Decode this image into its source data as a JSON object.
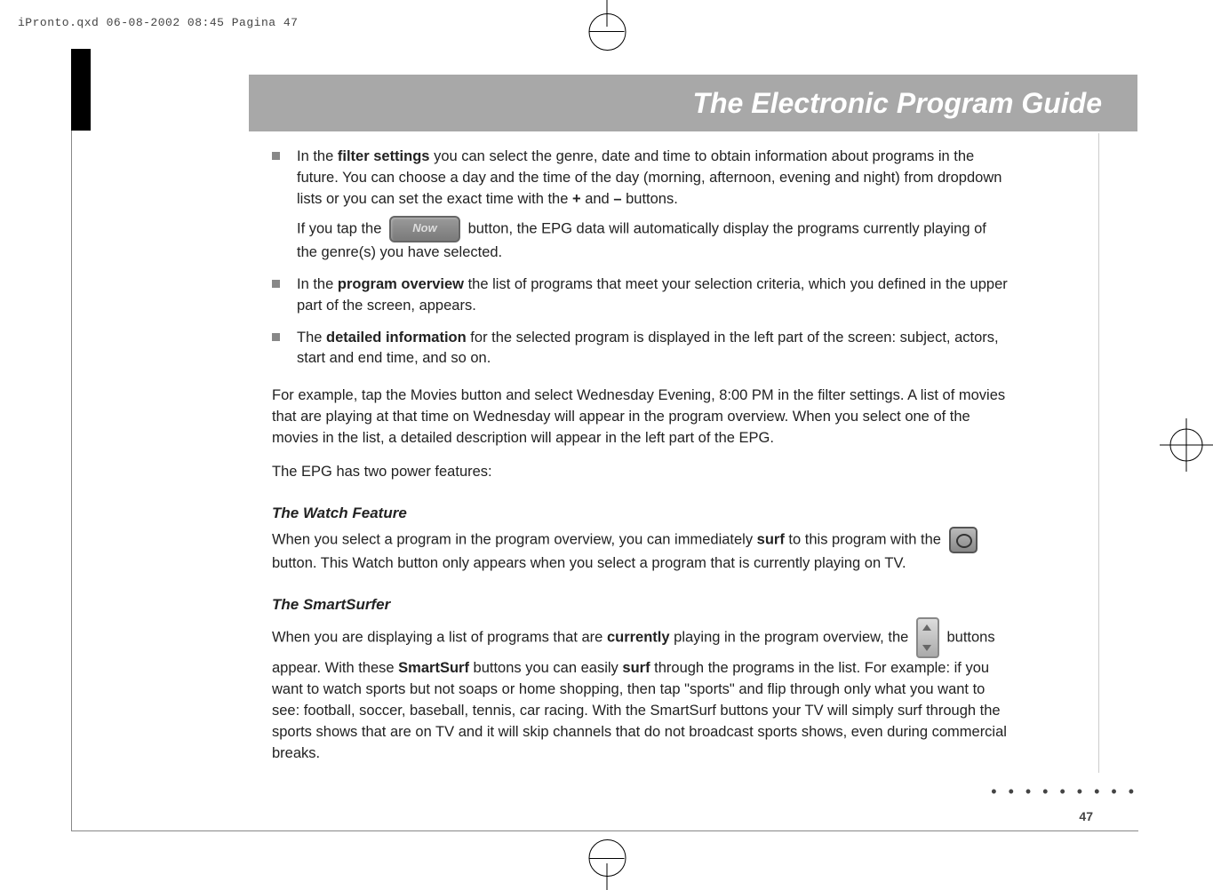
{
  "headerLine": "iPronto.qxd  06-08-2002  08:45  Pagina 47",
  "title": "The Electronic Program Guide",
  "bullets": {
    "b1_pre": "In the ",
    "b1_bold1": "filter settings",
    "b1_mid": " you can select the genre, date and time to obtain information about programs in the future. You can choose a day and the time of the day (morning, afternoon, evening and night) from dropdown lists or you can set the exact time with the ",
    "b1_plus": "+",
    "b1_and": " and ",
    "b1_minus": "–",
    "b1_end": " buttons.",
    "b1_line2_pre": "If you tap the ",
    "b1_nowLabel": "Now",
    "b1_line2_post": " button, the EPG data will automatically display the programs currently playing of the genre(s) you have selected.",
    "b2_pre": "In the ",
    "b2_bold": "program overview",
    "b2_post": " the list of programs that meet your selection criteria, which you defined in the upper part of the screen, appears.",
    "b3_pre": "The ",
    "b3_bold": "detailed information",
    "b3_post": " for the selected program is displayed in the left part of the screen: subject, actors, start and end time, and so on."
  },
  "examplePara": "For example, tap the Movies button and select Wednesday Evening, 8:00 PM in the filter settings. A list of movies that are playing at that time on Wednesday will appear in the program overview. When you select one of the movies in the list, a detailed description will appear in the left part of the EPG.",
  "powerFeatures": "The EPG has two power features:",
  "watch": {
    "title": "The Watch Feature",
    "pre": "When you select a program in the program overview, you can immediately ",
    "bold": "surf",
    "mid": " to this program with the ",
    "post": " button. This Watch button only appears when you select a program that is currently playing on TV."
  },
  "smart": {
    "title": "The SmartSurfer",
    "pre": "When you are displaying a list of programs that are ",
    "bold1": "currently",
    "mid1": " playing in the program overview, the ",
    "mid2": " buttons appear. With these ",
    "bold2": "SmartSurf",
    "mid3": " buttons you can easily ",
    "bold3": "surf",
    "post": " through the programs in the list. For example: if you want to watch sports but not soaps or home shopping, then tap \"sports\" and flip through only what you want to see: football, soccer, baseball, tennis, car racing. With the SmartSurf buttons your TV will simply surf through the sports shows that are on TV and it will skip channels that do not broadcast sports shows, even during commercial breaks."
  },
  "pageNumber": "47",
  "dots": "• • • • • • • • •"
}
